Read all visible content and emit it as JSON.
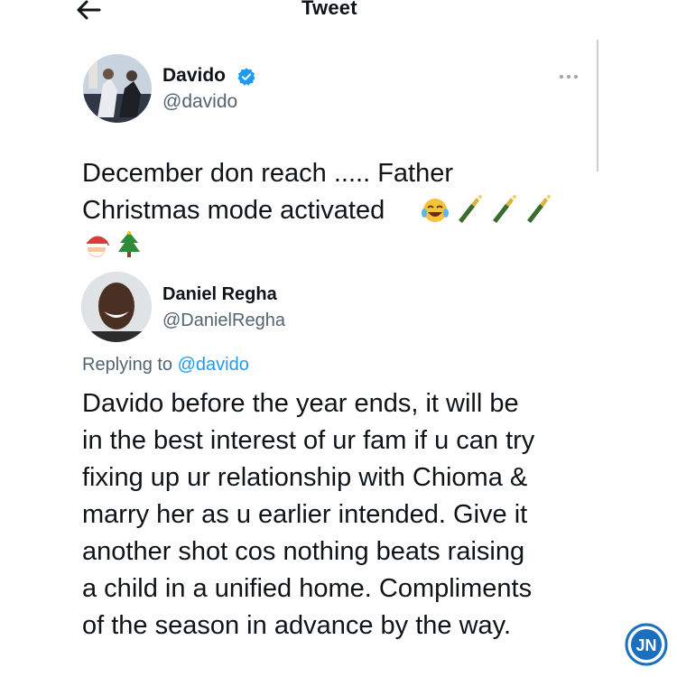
{
  "header": {
    "title": "Tweet",
    "back_icon": "arrow-left-icon"
  },
  "tweet": {
    "author_name": "Davido",
    "author_handle": "@davido",
    "verified": true,
    "verified_color": "#1d9bf0",
    "text_line1": "December don reach ..... Father",
    "text_line2": "Christmas mode activated",
    "emojis_line2": [
      "face-with-tears-of-joy",
      "champagne-bottle",
      "champagne-bottle",
      "champagne-bottle"
    ],
    "emojis_line3": [
      "santa-face",
      "christmas-tree"
    ]
  },
  "reply": {
    "author_name": "Daniel Regha",
    "author_handle": "@DanielRegha",
    "replying_prefix": "Replying to",
    "replying_to": "@davido",
    "lines": [
      "Davido before the year ends, it will be",
      "in the best interest of ur fam if u can try",
      "fixing up ur relationship with Chioma &",
      "marry her as u earlier intended. Give it",
      "another shot cos nothing beats raising",
      "a child in a unified home. Compliments",
      "of the season in advance by the way."
    ]
  },
  "watermark": {
    "text": "JN",
    "color": "#1a6fbf"
  },
  "colors": {
    "text": "#0f1419",
    "secondary": "#536471",
    "link": "#1d9bf0"
  }
}
